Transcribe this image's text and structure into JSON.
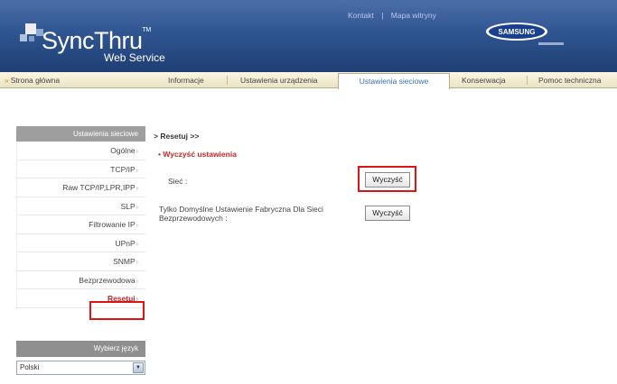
{
  "header": {
    "logo_text": "SyncThru",
    "logo_tm": "TM",
    "logo_sub": "Web Service",
    "top_links": [
      "Kontakt",
      "|",
      "Mapa witryny"
    ],
    "brand": "SAMSUNG",
    "colors": {
      "header_bg": "#2f5591",
      "nav_bg": "#ece3c4",
      "highlight": "#e01313"
    }
  },
  "nav": {
    "home": "Strona główna",
    "tabs": [
      "Informacje",
      "Ustawienia urządzenia",
      "Ustawienia sieciowe",
      "Konserwacja",
      "Pomoc techniczna"
    ],
    "active_tab": "Ustawienia sieciowe"
  },
  "sidebar": {
    "header": "Ustawienia sieciowe",
    "items": [
      {
        "label": "Ogólne"
      },
      {
        "label": "TCP/IP"
      },
      {
        "label": "Raw TCP/IP,LPR,IPP"
      },
      {
        "label": "SLP"
      },
      {
        "label": "Filtrowanie IP"
      },
      {
        "label": "UPnP"
      },
      {
        "label": "SNMP"
      },
      {
        "label": "Bezprzewodowa"
      },
      {
        "label": "Resetuj"
      }
    ],
    "active_item": "Resetuj",
    "language_header": "Wybierz język",
    "language_value": "Polski"
  },
  "main": {
    "breadcrumb": "> Resetuj >>",
    "section_title": "Wyczyść ustawienia",
    "rows": [
      {
        "label": "Sieć :",
        "button": "Wyczyść"
      },
      {
        "label": "Tylko Domyślne Ustawienie Fabryczna Dla Sieci Bezprzewodowych :",
        "button": "Wyczyść"
      }
    ]
  }
}
